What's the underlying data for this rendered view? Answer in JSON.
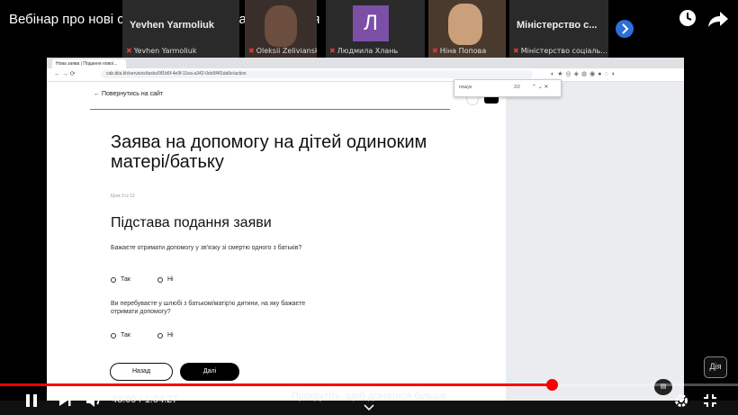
{
  "video_title": "Вебінар про нові соціальні послуги на порталі Дія",
  "participants": [
    {
      "name": "Yevhen Yarmoliuk",
      "overlay": "Yevhen Yarmoliuk"
    },
    {
      "name": "Oleksii Zelivianskyi"
    },
    {
      "name": "Людмила Хлань",
      "initial": "Л"
    },
    {
      "name": "Ніна Попова"
    },
    {
      "name": "Міністерство соціаль...",
      "overlay": "Міністерство с..."
    }
  ],
  "browser": {
    "tab_title": "Нова заява | Подання нової...",
    "url": "cab.diia.kh/services/tasks/9f1b6f-4e9f-11ea-a342-0eb5f4f1da5e/action",
    "find_text": "пошук",
    "find_count": "2/2"
  },
  "form": {
    "back_link": "Повернутись на сайт",
    "heading": "Заява на допомогу на дітей одиноким матері/батьку",
    "step": "Крок 3 із 13",
    "section_title": "Підстава подання заяви",
    "q1": "Бажаєте отримати допомогу у зв'язку зі смертю одного з батьків?",
    "q2": "Ви перебуваєте у шлюбі з батьком/матір'ю дитини, на яку бажаєте отримати допомогу?",
    "yes": "Так",
    "no": "Ні",
    "back_button": "Назад",
    "next_button": "Далі"
  },
  "player": {
    "time": "48:09 / 1:04:27",
    "progress": 0.747,
    "scroll_hint": "Прокрутіть, щоб дізнатися більше",
    "channel_badge": "Дія"
  },
  "colors": {
    "progress": "#ff0000",
    "page_bg": "#ffffff"
  }
}
